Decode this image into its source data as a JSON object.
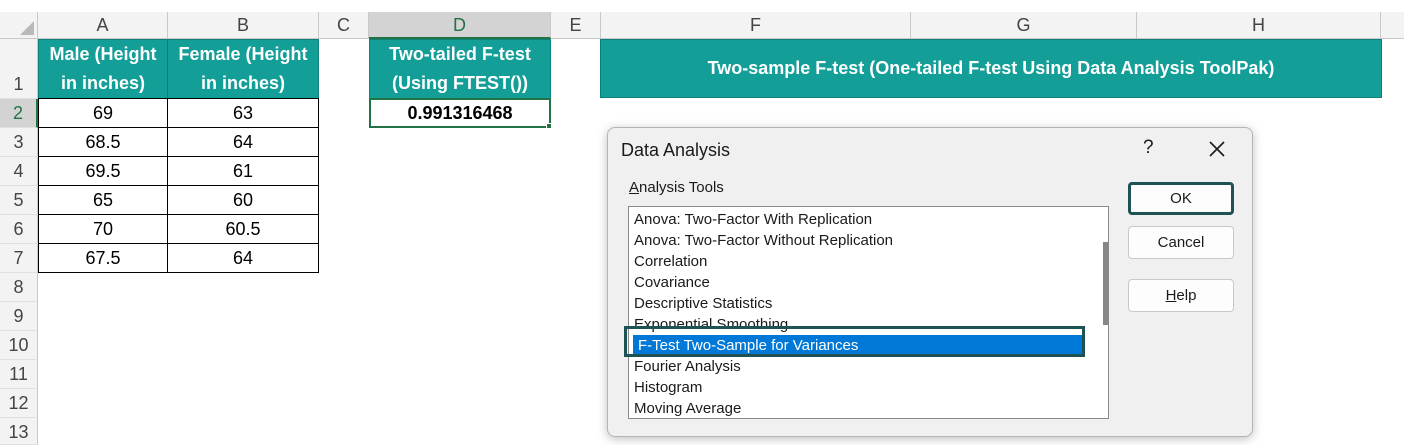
{
  "columns": [
    "A",
    "B",
    "C",
    "D",
    "E",
    "F",
    "G",
    "H"
  ],
  "active_column": "D",
  "rows": [
    "1",
    "2",
    "3",
    "4",
    "5",
    "6",
    "7",
    "8",
    "9",
    "10",
    "11",
    "12",
    "13"
  ],
  "active_row": "2",
  "table": {
    "male_header_line1": "Male (Height",
    "male_header_line2": "in inches)",
    "female_header_line1": "Female (Height",
    "female_header_line2": "in inches)",
    "male": [
      "69",
      "68.5",
      "69.5",
      "65",
      "70",
      "67.5"
    ],
    "female": [
      "63",
      "64",
      "61",
      "60",
      "60.5",
      "64"
    ]
  },
  "ftest": {
    "header_line1": "Two-tailed F-test",
    "header_line2": "(Using FTEST())",
    "value": "0.991316468"
  },
  "banner": "Two-sample F-test (One-tailed F-test Using Data Analysis ToolPak)",
  "dialog": {
    "title": "Data Analysis",
    "help_symbol": "?",
    "tools_label_accel": "A",
    "tools_label_rest": "nalysis Tools",
    "items": [
      "Anova: Two-Factor With Replication",
      "Anova: Two-Factor Without Replication",
      "Correlation",
      "Covariance",
      "Descriptive Statistics",
      "Exponential Smoothing",
      "F-Test Two-Sample for Variances",
      "Fourier Analysis",
      "Histogram",
      "Moving Average"
    ],
    "selected_item": "F-Test Two-Sample for Variances",
    "ok_label": "OK",
    "cancel_label": "Cancel",
    "help_accel": "H",
    "help_rest": "elp"
  },
  "colors": {
    "header_teal": "#139f98",
    "selection_green": "#217346",
    "list_selected": "#0078d7",
    "outline_dark": "#1e5253"
  }
}
